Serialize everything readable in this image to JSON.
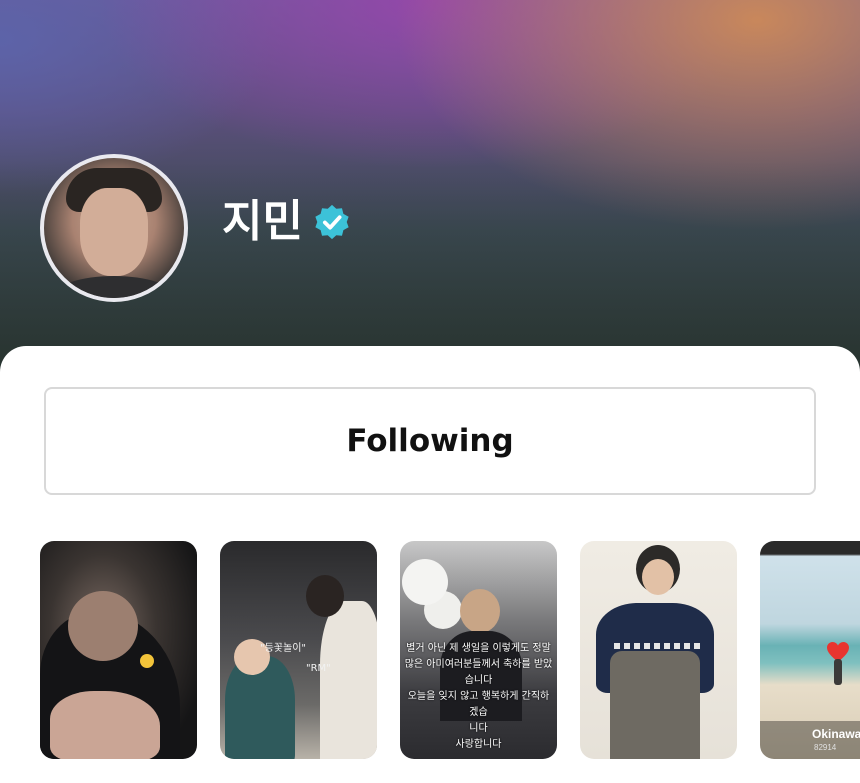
{
  "profile": {
    "name": "지민",
    "verified": true,
    "verified_icon": "verified-badge-icon",
    "accent_color": "#3cc2d8"
  },
  "actions": {
    "follow_label": "Following"
  },
  "thumbnails": [
    {
      "captions": []
    },
    {
      "captions": [
        "\"등꽃놀이\"",
        "\"RM\""
      ]
    },
    {
      "overlay_text": [
        "별거 아닌 제 생일을 이렇게도 정말",
        "많은 아미여러분들께서 축하를 받았",
        "습니다",
        "오늘을 잊지 않고 행복하게 간직하겠습",
        "니다",
        "사랑합니다"
      ]
    },
    {
      "captions": []
    },
    {
      "location": "Okinawa",
      "number": "82914"
    }
  ]
}
